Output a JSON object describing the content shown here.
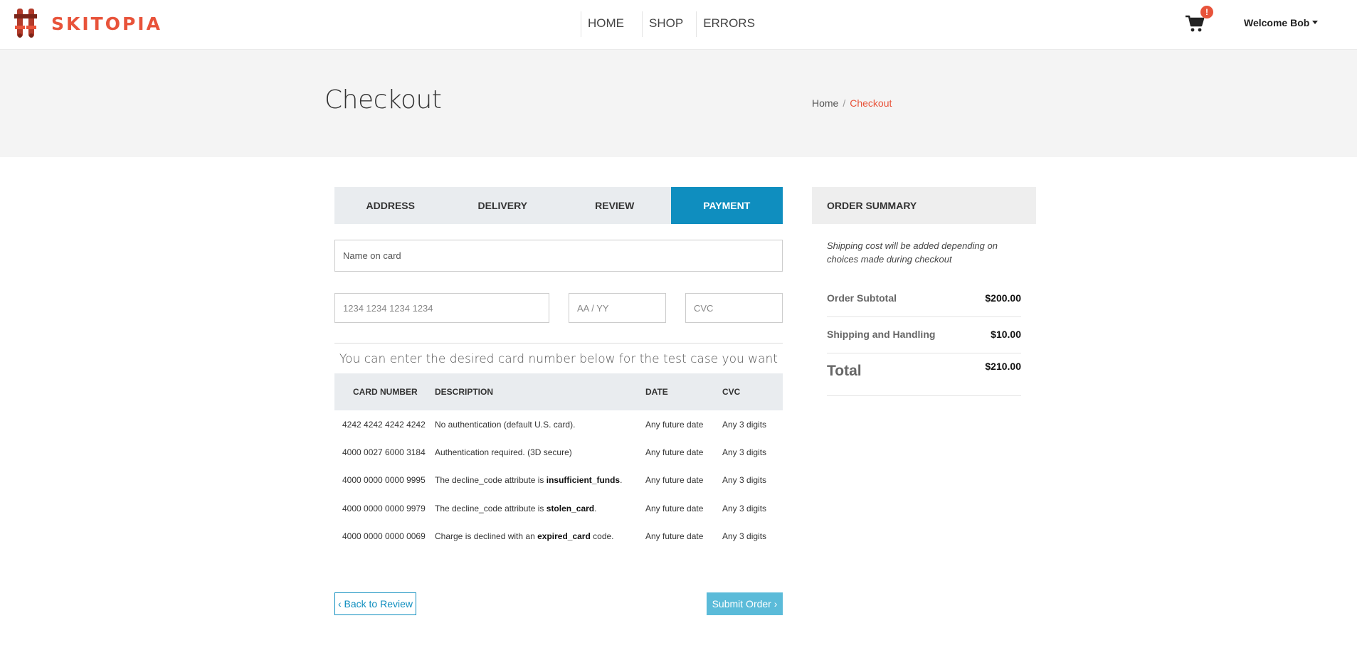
{
  "brand": {
    "name": "SKITOPIA",
    "accent": "#e8533a"
  },
  "nav": {
    "home": "HOME",
    "shop": "SHOP",
    "errors": "ERRORS"
  },
  "cart": {
    "badge": "!"
  },
  "user": {
    "welcome": "Welcome Bob"
  },
  "page": {
    "title": "Checkout"
  },
  "breadcrumb": {
    "home": "Home",
    "sep": "/",
    "current": "Checkout"
  },
  "tabs": [
    {
      "label": "ADDRESS"
    },
    {
      "label": "DELIVERY"
    },
    {
      "label": "REVIEW"
    },
    {
      "label": "PAYMENT",
      "active": true
    }
  ],
  "form": {
    "name_on_card": "Name on card",
    "card_number_placeholder": "1234 1234 1234 1234",
    "expiry_placeholder": "AA / YY",
    "cvc_placeholder": "CVC"
  },
  "test_note": "You can enter the desired card number below for the test case you want",
  "table": {
    "headers": {
      "card": "CARD NUMBER",
      "desc": "DESCRIPTION",
      "date": "DATE",
      "cvc": "CVC"
    },
    "rows": [
      {
        "card": "4242 4242 4242 4242",
        "desc_pre": "No authentication (default U.S. card).",
        "desc_bold": "",
        "desc_post": "",
        "date": "Any future date",
        "cvc": "Any 3 digits"
      },
      {
        "card": "4000 0027 6000 3184",
        "desc_pre": "Authentication required. (3D secure)",
        "desc_bold": "",
        "desc_post": "",
        "date": "Any future date",
        "cvc": "Any 3 digits"
      },
      {
        "card": "4000 0000 0000 9995",
        "desc_pre": "The decline_code attribute is ",
        "desc_bold": "insufficient_funds",
        "desc_post": ".",
        "date": "Any future date",
        "cvc": "Any 3 digits"
      },
      {
        "card": "4000 0000 0000 9979",
        "desc_pre": "The decline_code attribute is ",
        "desc_bold": "stolen_card",
        "desc_post": ".",
        "date": "Any future date",
        "cvc": "Any 3 digits"
      },
      {
        "card": "4000 0000 0000 0069",
        "desc_pre": "Charge is declined with an ",
        "desc_bold": "expired_card",
        "desc_post": " code.",
        "date": "Any future date",
        "cvc": "Any 3 digits"
      }
    ]
  },
  "buttons": {
    "back": "‹ Back to Review",
    "submit": "Submit Order ›"
  },
  "summary": {
    "title": "ORDER SUMMARY",
    "note": "Shipping cost will be added depending on choices made during checkout",
    "subtotal_label": "Order Subtotal",
    "subtotal_value": "$200.00",
    "shipping_label": "Shipping and Handling",
    "shipping_value": "$10.00",
    "total_label": "Total",
    "total_value": "$210.00"
  }
}
